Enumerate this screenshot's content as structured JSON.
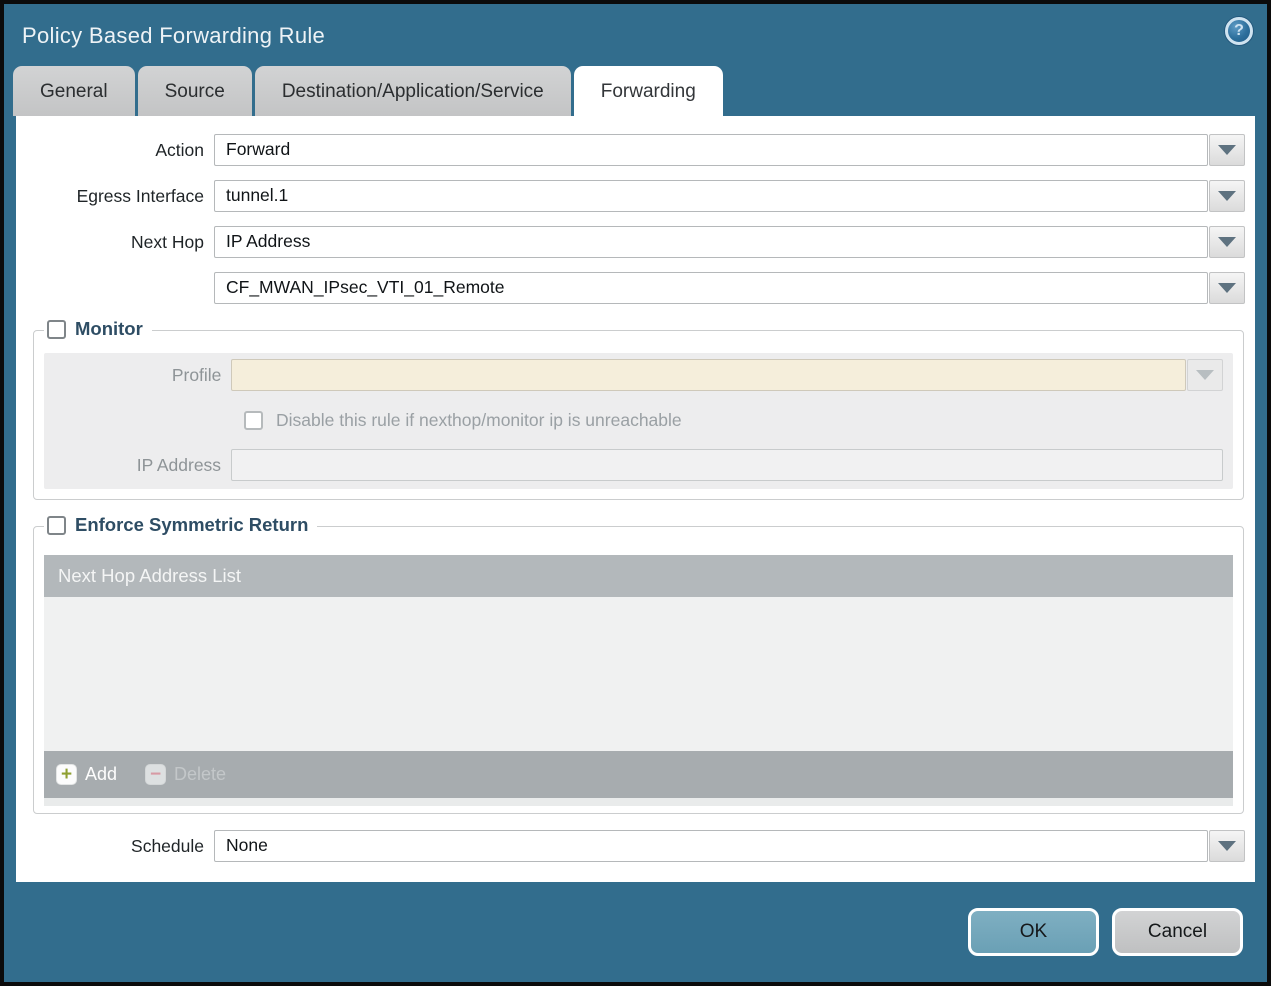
{
  "window": {
    "title": "Policy Based Forwarding Rule"
  },
  "icons": {
    "help": "?",
    "add_plus": "+",
    "delete_minus": "−"
  },
  "tabs": [
    {
      "label": "General"
    },
    {
      "label": "Source"
    },
    {
      "label": "Destination/Application/Service"
    },
    {
      "label": "Forwarding"
    }
  ],
  "active_tab": "Forwarding",
  "form": {
    "action_label": "Action",
    "action_value": "Forward",
    "egress_label": "Egress Interface",
    "egress_value": "tunnel.1",
    "next_hop_label": "Next Hop",
    "next_hop_value": "IP Address",
    "next_hop_address_value": "CF_MWAN_IPsec_VTI_01_Remote",
    "schedule_label": "Schedule",
    "schedule_value": "None"
  },
  "monitor": {
    "legend": "Monitor",
    "checkbox_checked": false,
    "profile_label": "Profile",
    "profile_value": "",
    "disable_rule_label": "Disable this rule if nexthop/monitor ip is unreachable",
    "disable_rule_checked": false,
    "ip_address_label": "IP Address",
    "ip_address_value": ""
  },
  "enforce": {
    "legend": "Enforce Symmetric Return",
    "checkbox_checked": false,
    "table_header": "Next Hop Address List",
    "table_rows": [],
    "add_label": "Add",
    "delete_label": "Delete"
  },
  "footer": {
    "ok_label": "OK",
    "cancel_label": "Cancel"
  },
  "colors": {
    "frame_teal": "#326d8d",
    "ok_button": "#74a6ba",
    "disabled_beige": "#f5eedb",
    "table_header_gray": "#b3b8bb",
    "legend_blue": "#2e4d64"
  }
}
